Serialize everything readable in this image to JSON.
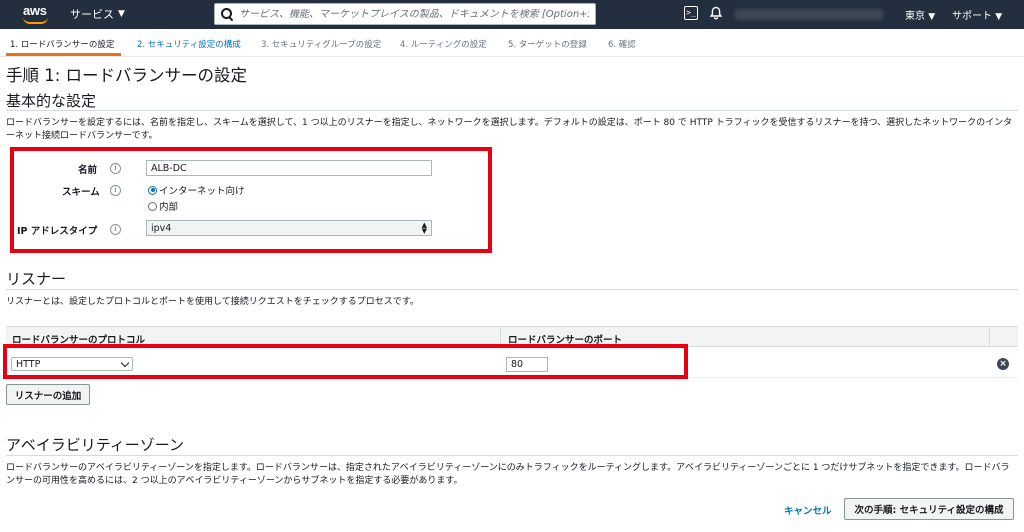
{
  "nav": {
    "logo_text": "aws",
    "services_label": "サービス",
    "search_placeholder": "サービス、機能、マーケットプレイスの製品、ドキュメントを検索 [Option+S]",
    "region_label": "東京",
    "support_label": "サポート"
  },
  "steps": [
    {
      "label": "1. ロードバランサーの設定"
    },
    {
      "label": "2. セキュリティ設定の構成"
    },
    {
      "label": "3. セキュリティグループの設定"
    },
    {
      "label": "4. ルーティングの設定"
    },
    {
      "label": "5. ターゲットの登録"
    },
    {
      "label": "6. 確認"
    }
  ],
  "page_title": "手順 1: ロードバランサーの設定",
  "basic": {
    "heading": "基本的な設定",
    "description": "ロードバランサーを設定するには、名前を指定し、スキームを選択して、1 つ以上のリスナーを指定し、ネットワークを選択します。デフォルトの設定は、ポート 80 で HTTP トラフィックを受信するリスナーを持つ、選択したネットワークのインターネット接続ロードバランサーです。",
    "name_label": "名前",
    "name_value": "ALB-DC",
    "scheme_label": "スキーム",
    "scheme_options": [
      "インターネット向け",
      "内部"
    ],
    "ip_type_label": "IP アドレスタイプ",
    "ip_type_value": "ipv4",
    "info_glyph": "i"
  },
  "listeners": {
    "heading": "リスナー",
    "description": "リスナーとは、設定したプロトコルとポートを使用して接続リクエストをチェックするプロセスです。",
    "col_protocol": "ロードバランサーのプロトコル",
    "col_port": "ロードバランサーのポート",
    "protocol_value": "HTTP",
    "port_value": "80",
    "add_button": "リスナーの追加"
  },
  "az": {
    "heading": "アベイラビリティーゾーン",
    "description": "ロードバランサーのアベイラビリティーゾーンを指定します。ロードバランサーは、指定されたアベイラビリティーゾーンにのみトラフィックをルーティングします。アベイラビリティーゾーンごとに 1 つだけサブネットを指定できます。ロードバランサーの可用性を高めるには、2 つ以上のアベイラビリティーゾーンからサブネットを指定する必要があります。"
  },
  "footer": {
    "cancel": "キャンセル",
    "next": "次の手順: セキュリティ設定の構成"
  },
  "colors": {
    "nav_bg": "#232f3e",
    "accent_orange": "#ec7211",
    "link_blue": "#0073bb",
    "highlight_red": "#e60012"
  }
}
